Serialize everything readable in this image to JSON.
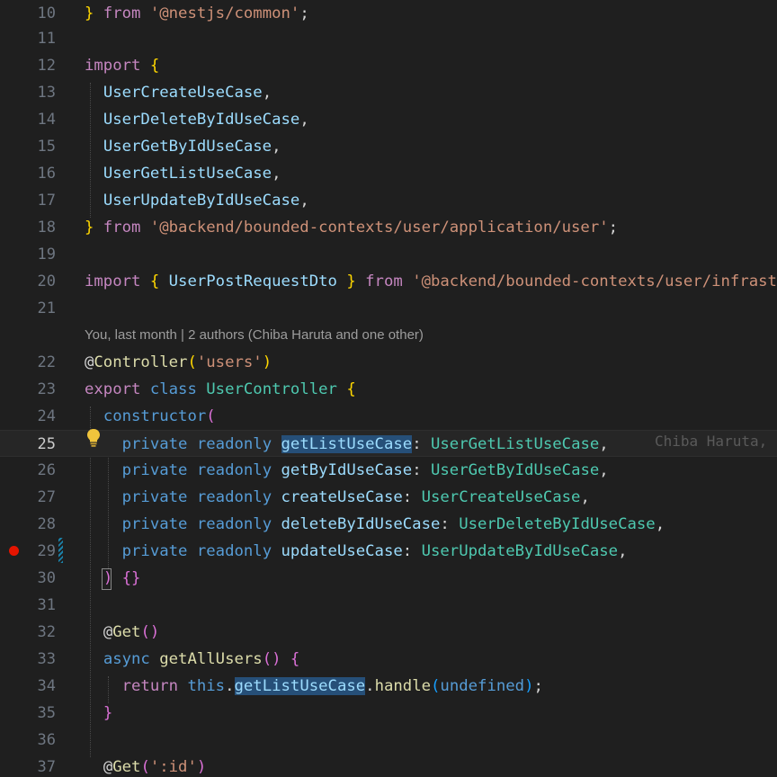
{
  "editor": {
    "blame_annotation": "You, last month | 2 authors (Chiba Haruta and one other)",
    "inline_blame": "Chiba Haruta,",
    "lightbulb_icon": "lightbulb-icon",
    "breakpoint_color": "#e51400",
    "current_line": "25",
    "lines": [
      {
        "n": "10",
        "tokens": [
          {
            "t": "}",
            "c": "br"
          },
          {
            "t": " from ",
            "c": "kw"
          },
          {
            "t": "'@nestjs/common'",
            "c": "str"
          },
          {
            "t": ";",
            "c": "pu"
          }
        ]
      },
      {
        "n": "11",
        "tokens": []
      },
      {
        "n": "12",
        "tokens": [
          {
            "t": "import",
            "c": "kw"
          },
          {
            "t": " "
          },
          {
            "t": "{",
            "c": "br"
          }
        ]
      },
      {
        "n": "13",
        "tokens": [
          {
            "t": "  "
          },
          {
            "t": "UserCreateUseCase",
            "c": "id"
          },
          {
            "t": ",",
            "c": "pu"
          }
        ]
      },
      {
        "n": "14",
        "tokens": [
          {
            "t": "  "
          },
          {
            "t": "UserDeleteByIdUseCase",
            "c": "id"
          },
          {
            "t": ",",
            "c": "pu"
          }
        ]
      },
      {
        "n": "15",
        "tokens": [
          {
            "t": "  "
          },
          {
            "t": "UserGetByIdUseCase",
            "c": "id"
          },
          {
            "t": ",",
            "c": "pu"
          }
        ]
      },
      {
        "n": "16",
        "tokens": [
          {
            "t": "  "
          },
          {
            "t": "UserGetListUseCase",
            "c": "id"
          },
          {
            "t": ",",
            "c": "pu"
          }
        ]
      },
      {
        "n": "17",
        "tokens": [
          {
            "t": "  "
          },
          {
            "t": "UserUpdateByIdUseCase",
            "c": "id"
          },
          {
            "t": ",",
            "c": "pu"
          }
        ]
      },
      {
        "n": "18",
        "tokens": [
          {
            "t": "}",
            "c": "br"
          },
          {
            "t": " from ",
            "c": "kw"
          },
          {
            "t": "'@backend/bounded-contexts/user/application/user'",
            "c": "str"
          },
          {
            "t": ";",
            "c": "pu"
          }
        ]
      },
      {
        "n": "19",
        "tokens": []
      },
      {
        "n": "20",
        "tokens": [
          {
            "t": "import",
            "c": "kw"
          },
          {
            "t": " "
          },
          {
            "t": "{",
            "c": "br"
          },
          {
            "t": " "
          },
          {
            "t": "UserPostRequestDto",
            "c": "id"
          },
          {
            "t": " "
          },
          {
            "t": "}",
            "c": "br"
          },
          {
            "t": " from ",
            "c": "kw"
          },
          {
            "t": "'@backend/bounded-contexts/user/infrastruc",
            "c": "str"
          }
        ]
      },
      {
        "n": "21",
        "tokens": []
      },
      {
        "n": "22",
        "tokens": [
          {
            "t": "@",
            "c": "pu"
          },
          {
            "t": "Controller",
            "c": "fn"
          },
          {
            "t": "(",
            "c": "br"
          },
          {
            "t": "'users'",
            "c": "str"
          },
          {
            "t": ")",
            "c": "br"
          }
        ]
      },
      {
        "n": "23",
        "tokens": [
          {
            "t": "export",
            "c": "kw"
          },
          {
            "t": " "
          },
          {
            "t": "class",
            "c": "kwb"
          },
          {
            "t": " "
          },
          {
            "t": "UserController",
            "c": "cls"
          },
          {
            "t": " "
          },
          {
            "t": "{",
            "c": "br"
          }
        ]
      },
      {
        "n": "24",
        "tokens": [
          {
            "t": "  "
          },
          {
            "t": "constructor",
            "c": "kwb"
          },
          {
            "t": "(",
            "c": "br2"
          }
        ]
      },
      {
        "n": "25",
        "tokens": [
          {
            "t": "    "
          },
          {
            "t": "private",
            "c": "kwb"
          },
          {
            "t": " "
          },
          {
            "t": "readonly",
            "c": "kwb"
          },
          {
            "t": " "
          },
          {
            "t": "getListUseCase",
            "c": "id hl"
          },
          {
            "t": ": ",
            "c": "pu"
          },
          {
            "t": "UserGetListUseCase",
            "c": "cls"
          },
          {
            "t": ",",
            "c": "pu"
          }
        ]
      },
      {
        "n": "26",
        "tokens": [
          {
            "t": "    "
          },
          {
            "t": "private",
            "c": "kwb"
          },
          {
            "t": " "
          },
          {
            "t": "readonly",
            "c": "kwb"
          },
          {
            "t": " "
          },
          {
            "t": "getByIdUseCase",
            "c": "id"
          },
          {
            "t": ": ",
            "c": "pu"
          },
          {
            "t": "UserGetByIdUseCase",
            "c": "cls"
          },
          {
            "t": ",",
            "c": "pu"
          }
        ]
      },
      {
        "n": "27",
        "tokens": [
          {
            "t": "    "
          },
          {
            "t": "private",
            "c": "kwb"
          },
          {
            "t": " "
          },
          {
            "t": "readonly",
            "c": "kwb"
          },
          {
            "t": " "
          },
          {
            "t": "createUseCase",
            "c": "id"
          },
          {
            "t": ": ",
            "c": "pu"
          },
          {
            "t": "UserCreateUseCase",
            "c": "cls"
          },
          {
            "t": ",",
            "c": "pu"
          }
        ]
      },
      {
        "n": "28",
        "tokens": [
          {
            "t": "    "
          },
          {
            "t": "private",
            "c": "kwb"
          },
          {
            "t": " "
          },
          {
            "t": "readonly",
            "c": "kwb"
          },
          {
            "t": " "
          },
          {
            "t": "deleteByIdUseCase",
            "c": "id"
          },
          {
            "t": ": ",
            "c": "pu"
          },
          {
            "t": "UserDeleteByIdUseCase",
            "c": "cls"
          },
          {
            "t": ",",
            "c": "pu"
          }
        ]
      },
      {
        "n": "29",
        "tokens": [
          {
            "t": "    "
          },
          {
            "t": "private",
            "c": "kwb"
          },
          {
            "t": " "
          },
          {
            "t": "readonly",
            "c": "kwb"
          },
          {
            "t": " "
          },
          {
            "t": "updateUseCase",
            "c": "id"
          },
          {
            "t": ": ",
            "c": "pu"
          },
          {
            "t": "UserUpdateByIdUseCase",
            "c": "cls"
          },
          {
            "t": ",",
            "c": "pu"
          }
        ]
      },
      {
        "n": "30",
        "tokens": [
          {
            "t": "  "
          },
          {
            "t": ")",
            "c": "br2"
          },
          {
            "t": " "
          },
          {
            "t": "{}",
            "c": "br2"
          }
        ]
      },
      {
        "n": "31",
        "tokens": []
      },
      {
        "n": "32",
        "tokens": [
          {
            "t": "  "
          },
          {
            "t": "@",
            "c": "pu"
          },
          {
            "t": "Get",
            "c": "fn"
          },
          {
            "t": "()",
            "c": "br2"
          }
        ]
      },
      {
        "n": "33",
        "tokens": [
          {
            "t": "  "
          },
          {
            "t": "async",
            "c": "kwb"
          },
          {
            "t": " "
          },
          {
            "t": "getAllUsers",
            "c": "fn"
          },
          {
            "t": "()",
            "c": "br2"
          },
          {
            "t": " "
          },
          {
            "t": "{",
            "c": "br2"
          }
        ]
      },
      {
        "n": "34",
        "tokens": [
          {
            "t": "    "
          },
          {
            "t": "return",
            "c": "kw"
          },
          {
            "t": " "
          },
          {
            "t": "this",
            "c": "kwb"
          },
          {
            "t": ".",
            "c": "pu"
          },
          {
            "t": "getListUseCase",
            "c": "id hl"
          },
          {
            "t": ".",
            "c": "pu"
          },
          {
            "t": "handle",
            "c": "fn"
          },
          {
            "t": "(",
            "c": "br3"
          },
          {
            "t": "undefined",
            "c": "kwb"
          },
          {
            "t": ")",
            "c": "br3"
          },
          {
            "t": ";",
            "c": "pu"
          }
        ]
      },
      {
        "n": "35",
        "tokens": [
          {
            "t": "  "
          },
          {
            "t": "}",
            "c": "br2"
          }
        ]
      },
      {
        "n": "36",
        "tokens": []
      },
      {
        "n": "37",
        "tokens": [
          {
            "t": "  "
          },
          {
            "t": "@",
            "c": "pu"
          },
          {
            "t": "Get",
            "c": "fn"
          },
          {
            "t": "(",
            "c": "br2"
          },
          {
            "t": "':id'",
            "c": "str"
          },
          {
            "t": ")",
            "c": "br2"
          }
        ]
      }
    ]
  }
}
